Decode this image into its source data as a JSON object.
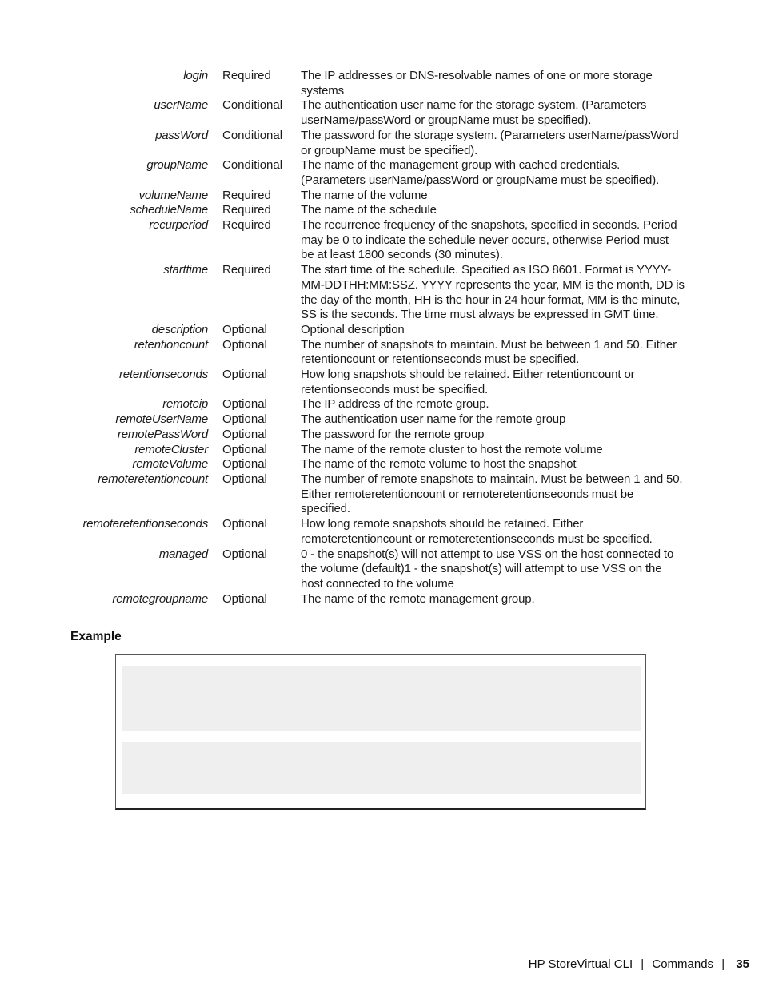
{
  "parameters": [
    {
      "name": "login",
      "requirement": "Required",
      "description": "The IP addresses or DNS-resolvable names of one or more storage systems"
    },
    {
      "name": "userName",
      "requirement": "Conditional",
      "description": "The authentication user name for the storage system. (Parameters userName/passWord or groupName must be specified)."
    },
    {
      "name": "passWord",
      "requirement": "Conditional",
      "description": "The password for the storage system. (Parameters userName/passWord or groupName must be specified)."
    },
    {
      "name": "groupName",
      "requirement": "Conditional",
      "description": "The name of the management group with cached credentials. (Parameters userName/passWord or groupName must be specified)."
    },
    {
      "name": "volumeName",
      "requirement": "Required",
      "description": "The name of the volume"
    },
    {
      "name": "scheduleName",
      "requirement": "Required",
      "description": "The name of the schedule"
    },
    {
      "name": "recurperiod",
      "requirement": "Required",
      "description": "The recurrence frequency of the snapshots, specified in seconds. Period may be 0 to indicate the schedule never occurs, otherwise Period must be at least 1800 seconds (30 minutes)."
    },
    {
      "name": "starttime",
      "requirement": "Required",
      "description": "The start time of the schedule. Specified as ISO 8601. Format is YYYY-MM-DDTHH:MM:SSZ. YYYY represents the year, MM is the month, DD is the day of the month, HH is the hour in 24 hour format, MM is the minute, SS is the seconds. The time must always be expressed in GMT time."
    },
    {
      "name": "description",
      "requirement": "Optional",
      "description": "Optional description"
    },
    {
      "name": "retentioncount",
      "requirement": "Optional",
      "description": "The number of snapshots to maintain. Must be between 1 and 50. Either retentioncount or retentionseconds must be specified."
    },
    {
      "name": "retentionseconds",
      "requirement": "Optional",
      "description": "How long snapshots should be retained. Either retentioncount or retentionseconds must be specified."
    },
    {
      "name": "remoteip",
      "requirement": "Optional",
      "description": "The IP address of the remote group."
    },
    {
      "name": "remoteUserName",
      "requirement": "Optional",
      "description": "The authentication user name for the remote group"
    },
    {
      "name": "remotePassWord",
      "requirement": "Optional",
      "description": "The password for the remote group"
    },
    {
      "name": "remoteCluster",
      "requirement": "Optional",
      "description": "The name of the remote cluster to host the remote volume"
    },
    {
      "name": "remoteVolume",
      "requirement": "Optional",
      "description": "The name of the remote volume to host the snapshot"
    },
    {
      "name": "remoteretentioncount",
      "requirement": "Optional",
      "description": "The number of remote snapshots to maintain. Must be between 1 and 50. Either remoteretentioncount or remoteretentionseconds must be specified."
    },
    {
      "name": "remoteretentionseconds",
      "requirement": "Optional",
      "description": "How long remote snapshots should be retained. Either remoteretentioncount or remoteretentionseconds must be specified."
    },
    {
      "name": "managed",
      "requirement": "Optional",
      "description": "0 - the snapshot(s) will not attempt to use VSS on the host connected to the volume (default)1 - the snapshot(s) will attempt to use VSS on the host connected to the volume"
    },
    {
      "name": "remotegroupname",
      "requirement": "Optional",
      "description": "The name of the remote management group."
    }
  ],
  "example": {
    "heading": "Example",
    "code_blocks": [
      "",
      ""
    ]
  },
  "footer": {
    "product": "HP StoreVirtual CLI",
    "separator": "|",
    "section": "Commands",
    "page_number": "35"
  }
}
